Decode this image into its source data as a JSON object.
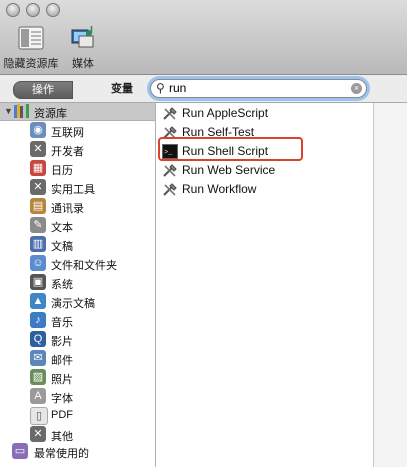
{
  "toolbar": {
    "hide_library_label": "隐藏资源库",
    "media_label": "媒体"
  },
  "filter": {
    "actions_tab": "操作",
    "variables_tab": "变量",
    "search_value": "run"
  },
  "library": {
    "root_label": "资源库",
    "items": [
      {
        "label": "互联网",
        "icon": "globe-icon",
        "color": "#6a8fbf",
        "glyph": "◉"
      },
      {
        "label": "开发者",
        "icon": "tools-icon",
        "color": "#6a6a6a",
        "glyph": "✕"
      },
      {
        "label": "日历",
        "icon": "calendar-icon",
        "color": "#c6473d",
        "glyph": "▦"
      },
      {
        "label": "实用工具",
        "icon": "utilities-icon",
        "color": "#6a6a6a",
        "glyph": "✕"
      },
      {
        "label": "通讯录",
        "icon": "address-book-icon",
        "color": "#b8863b",
        "glyph": "▤"
      },
      {
        "label": "文本",
        "icon": "text-icon",
        "color": "#8a8a8a",
        "glyph": "✎"
      },
      {
        "label": "文稿",
        "icon": "document-icon",
        "color": "#4d6fb0",
        "glyph": "▥"
      },
      {
        "label": "文件和文件夹",
        "icon": "finder-icon",
        "color": "#5b8ccf",
        "glyph": "☺"
      },
      {
        "label": "系统",
        "icon": "system-icon",
        "color": "#555555",
        "glyph": "▣"
      },
      {
        "label": "演示文稿",
        "icon": "presentation-icon",
        "color": "#3f86c9",
        "glyph": "▲"
      },
      {
        "label": "音乐",
        "icon": "music-icon",
        "color": "#3d7bc7",
        "glyph": "♪"
      },
      {
        "label": "影片",
        "icon": "movie-icon",
        "color": "#2f5fa3",
        "glyph": "Q"
      },
      {
        "label": "邮件",
        "icon": "mail-icon",
        "color": "#5d87b8",
        "glyph": "✉"
      },
      {
        "label": "照片",
        "icon": "photo-icon",
        "color": "#6b8d5a",
        "glyph": "▨"
      },
      {
        "label": "字体",
        "icon": "font-icon",
        "color": "#9a9a9a",
        "glyph": "A"
      },
      {
        "label": "PDF",
        "icon": "pdf-icon",
        "color": "#e6e6e6",
        "glyph": "▯"
      },
      {
        "label": "其他",
        "icon": "other-icon",
        "color": "#6a6a6a",
        "glyph": "✕"
      }
    ],
    "most_used_label": "最常使用的"
  },
  "results": [
    {
      "label": "Run AppleScript",
      "icon": "applescript-icon"
    },
    {
      "label": "Run Self-Test",
      "icon": "self-test-icon"
    },
    {
      "label": "Run Shell Script",
      "icon": "terminal-icon",
      "highlighted": true
    },
    {
      "label": "Run Web Service",
      "icon": "web-service-icon"
    },
    {
      "label": "Run Workflow",
      "icon": "workflow-icon"
    }
  ],
  "colors": {
    "highlight": "#e0402b",
    "search_focus": "#9cc3ef"
  }
}
